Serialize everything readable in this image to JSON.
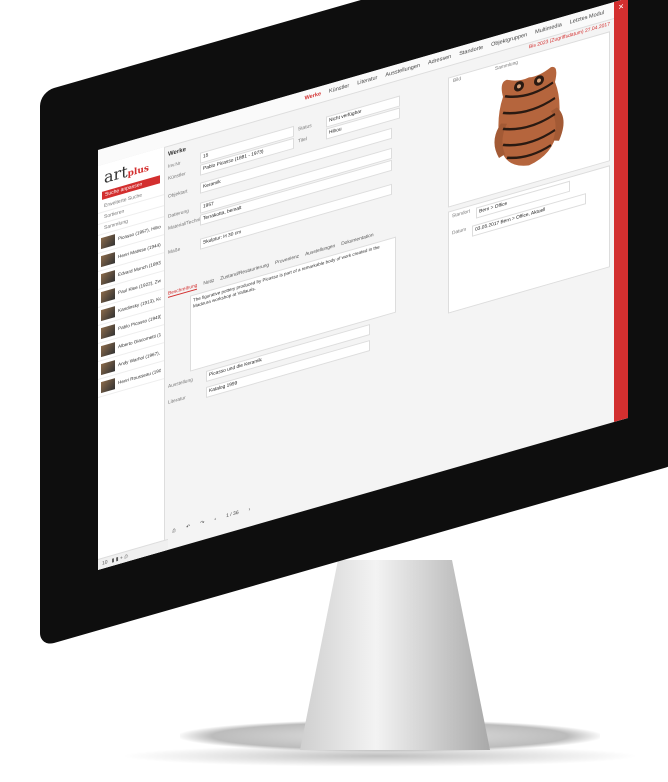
{
  "app": {
    "logo_main": "art",
    "logo_sub": "plus"
  },
  "header": {
    "nav": [
      "Werke",
      "Künstler",
      "Literatur",
      "Ausstellungen",
      "Adressen",
      "Standorte",
      "Objektgruppen",
      "Multimedia",
      "Letztes Modul"
    ],
    "active_nav": "Werke",
    "notice": "Bis 2023 (Zugriffsdatum) 27.04.2017"
  },
  "sidebar": {
    "search_bar": "Suche anpassen",
    "lines": [
      "Erweiterte Suche",
      "Sortieren",
      "Sammlung"
    ],
    "results": [
      "Picasso (1957), Hibou",
      "Henri Matisse (1944), Dame en jaune",
      "Edvard Munch (1893) Der Schrei",
      "Paul Klee (1922), Zwitschermaschine",
      "Kandinsky (1913), Komposition VII",
      "Pablo Picasso (1949), Taube",
      "Alberto Giacometti (1960), Mann",
      "Andy Warhol (1967), Marilyn",
      "Henri Rousseau (1905) Der Traum"
    ],
    "footer": "10"
  },
  "main": {
    "title": "Werke",
    "fields": [
      {
        "label": "Inv.Nr",
        "value": "15"
      },
      {
        "label": "Künstler",
        "value": "Pablo Picasso (1881 - 1973)"
      },
      {
        "label": "Status",
        "value": "Nicht verfügbar"
      },
      {
        "label": "Titel",
        "value": "Hibou"
      },
      {
        "label": "Objektart",
        "value": "Keramik"
      },
      {
        "label": "Datierung",
        "value": "1957"
      },
      {
        "label": "Material/Technik",
        "value": "Terrakotta, bemalt"
      },
      {
        "label": "Maße",
        "value": "Skulptur: H 30 cm"
      }
    ],
    "image_labels": [
      "Bild",
      "Sammlung"
    ],
    "tabs": [
      "Beschreibung",
      "Notiz",
      "Zustand/Restaurierung",
      "Provenienz",
      "Ausstellungen",
      "Dokumentation"
    ],
    "active_tab": "Beschreibung",
    "description": "The figurative pottery produced by Picasso is part of a remarkable body of work created in the Madoura workshop at Vallauris.",
    "right_panel": {
      "label_a": "Standort",
      "value_a": "Bern > Office",
      "label_b": "Datum",
      "value_b": "03.05.2017 Bern > Office, Aktuell"
    },
    "bottom": [
      {
        "label": "Ausstellung",
        "value": "Picasso und die Keramik"
      },
      {
        "label": "Literatur",
        "value": "Katalog 1999"
      }
    ],
    "pager": "1 / 36"
  }
}
